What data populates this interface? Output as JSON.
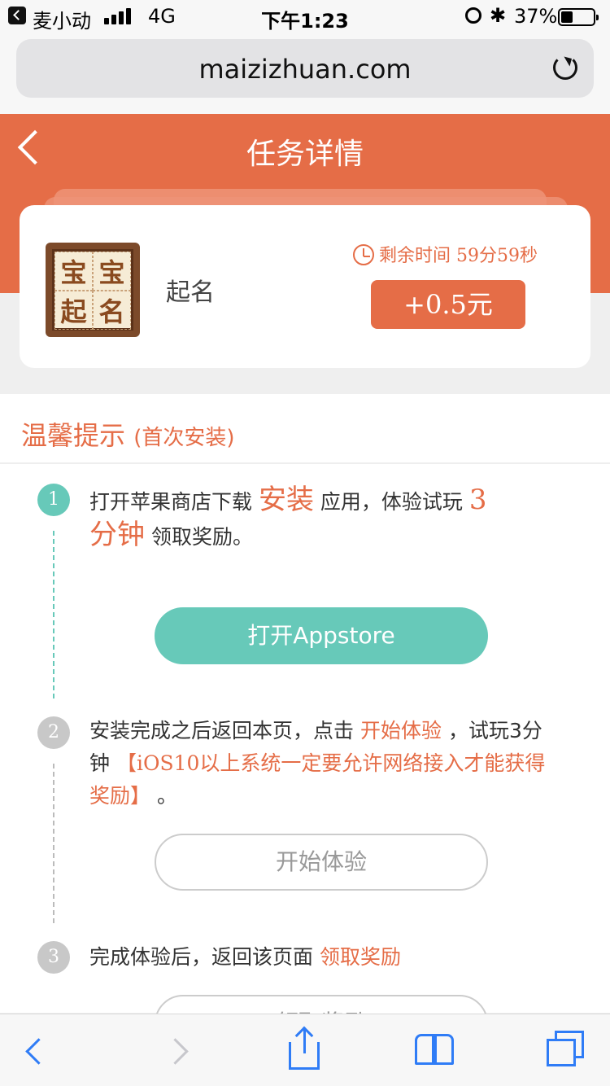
{
  "status_bar": {
    "carrier": "麦小动",
    "network": "4G",
    "time": "下午1:23",
    "battery": "37%",
    "bluetooth_glyph": "✱"
  },
  "browser": {
    "url": "maizizhuan.com"
  },
  "header": {
    "title": "任务详情"
  },
  "task": {
    "app_name": "起名",
    "app_icon_chars": [
      "宝",
      "宝",
      "起",
      "名"
    ],
    "remaining_label": "剩余时间",
    "remaining_value": "59分59秒",
    "reward": "+0.5元"
  },
  "tips": {
    "title": "温馨提示",
    "subtitle": "(首次安装)",
    "steps": [
      {
        "num": "1",
        "text_a": "打开苹果商店下载",
        "hl_a": "安装",
        "text_b": "应用，体验试玩",
        "hl_b": "3",
        "hl_c": "分钟",
        "text_c": "领取奖励。",
        "button": "打开Appstore"
      },
      {
        "num": "2",
        "text_a": "安装完成之后返回本页，点击",
        "hl_a": "开始体验",
        "text_b": "，试玩3分钟",
        "hl_b": "【iOS10以上系统一定要允许网络接入才能获得奖励】",
        "text_c": "。",
        "button": "开始体验"
      },
      {
        "num": "3",
        "text_a": "完成体验后，返回该页面",
        "hl_a": "领取奖励",
        "button": "领取奖励"
      }
    ]
  },
  "colors": {
    "accent": "#e56d47",
    "green": "#67c9b9",
    "ios_blue": "#2f7cf6"
  }
}
